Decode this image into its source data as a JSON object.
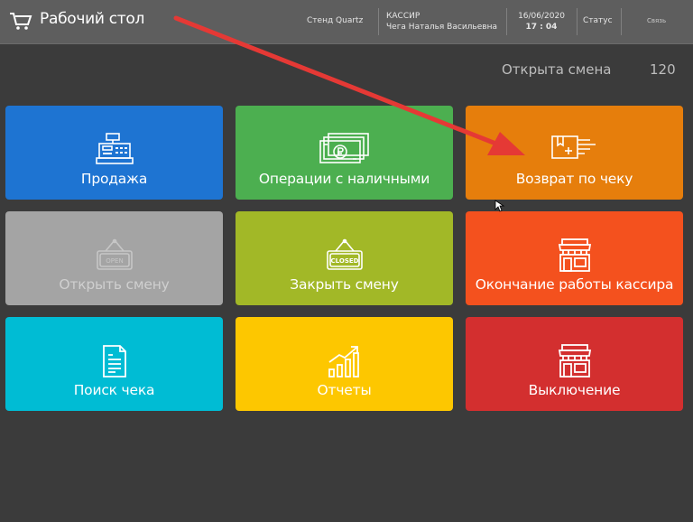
{
  "header": {
    "title": "Рабочий стол",
    "stand": "Стенд Quartz",
    "role": "КАССИР",
    "user": "Чега Наталья Васильевна",
    "date": "16/06/2020",
    "time": "17 : 04",
    "status": "Статус",
    "connection": "Связь"
  },
  "shift": {
    "label": "Открыта смена",
    "number": "120"
  },
  "tiles": [
    {
      "label": "Продажа",
      "icon": "cash-register-icon",
      "color": "#1e74d2",
      "enabled": true
    },
    {
      "label": "Операции с наличными",
      "icon": "banknotes-icon",
      "color": "#4caf50",
      "enabled": true
    },
    {
      "label": "Возврат по чеку",
      "icon": "return-box-icon",
      "color": "#e67e0c",
      "enabled": true
    },
    {
      "label": "Открыть смену",
      "icon": "open-sign-icon",
      "color": "#a4a4a4",
      "enabled": false,
      "sign": "OPEN"
    },
    {
      "label": "Закрыть смену",
      "icon": "closed-sign-icon",
      "color": "#a2b827",
      "enabled": true,
      "sign": "CLOSED"
    },
    {
      "label": "Окончание работы кассира",
      "icon": "store-icon",
      "color": "#f4511e",
      "enabled": true
    },
    {
      "label": "Поиск чека",
      "icon": "receipt-icon",
      "color": "#00bcd4",
      "enabled": true
    },
    {
      "label": "Отчеты",
      "icon": "chart-growth-icon",
      "color": "#fdc700",
      "enabled": true
    },
    {
      "label": "Выключение",
      "icon": "store-closed-icon",
      "color": "#d32f2f",
      "enabled": true
    }
  ],
  "annotation": {
    "arrow_color": "#e53935"
  }
}
